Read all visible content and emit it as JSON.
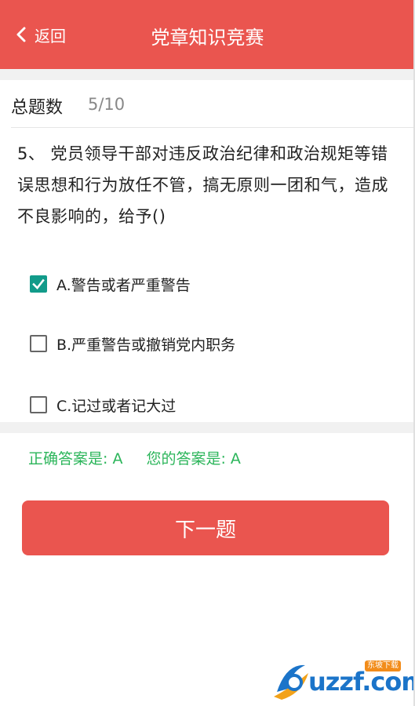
{
  "header": {
    "back_label": "返回",
    "title": "党章知识竞赛",
    "color": "#EA554F"
  },
  "progress": {
    "label": "总题数",
    "value": "5/10"
  },
  "question": {
    "text": "5、 党员领导干部对违反政治纪律和政治规矩等错误思想和行为放任不管，搞无原则一团和气，造成不良影响的，给予()"
  },
  "options": [
    {
      "label": "A.警告或者严重警告",
      "checked": true
    },
    {
      "label": "B.严重警告或撤销党内职务",
      "checked": false
    },
    {
      "label": "C.记过或者记大过",
      "checked": false
    }
  ],
  "answer": {
    "correct": "正确答案是: A",
    "yours": "您的答案是: A",
    "color": "#2bb55a"
  },
  "next_button": {
    "label": "下一题"
  },
  "watermark": {
    "text": "uzzf.com",
    "badge": "东坡下载"
  },
  "icons": {
    "back": "chevron-left-icon",
    "check": "checkmark-icon"
  }
}
